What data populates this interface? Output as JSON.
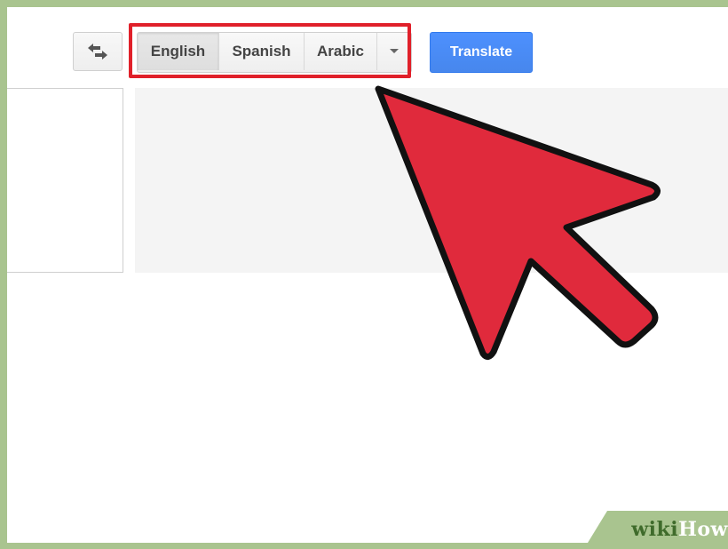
{
  "toolbar": {
    "swap_icon": "swap-languages-icon",
    "languages": [
      {
        "label": "English",
        "selected": true
      },
      {
        "label": "Spanish",
        "selected": false
      },
      {
        "label": "Arabic",
        "selected": false
      }
    ],
    "more_icon": "dropdown-caret-icon",
    "translate_label": "Translate"
  },
  "watermark": {
    "part1": "wiki",
    "part2": "How"
  },
  "colors": {
    "highlight": "#e0202a",
    "arrow": "#e02a3c",
    "translate_button": "#4d90fe",
    "frame_border": "#a9c48f"
  }
}
